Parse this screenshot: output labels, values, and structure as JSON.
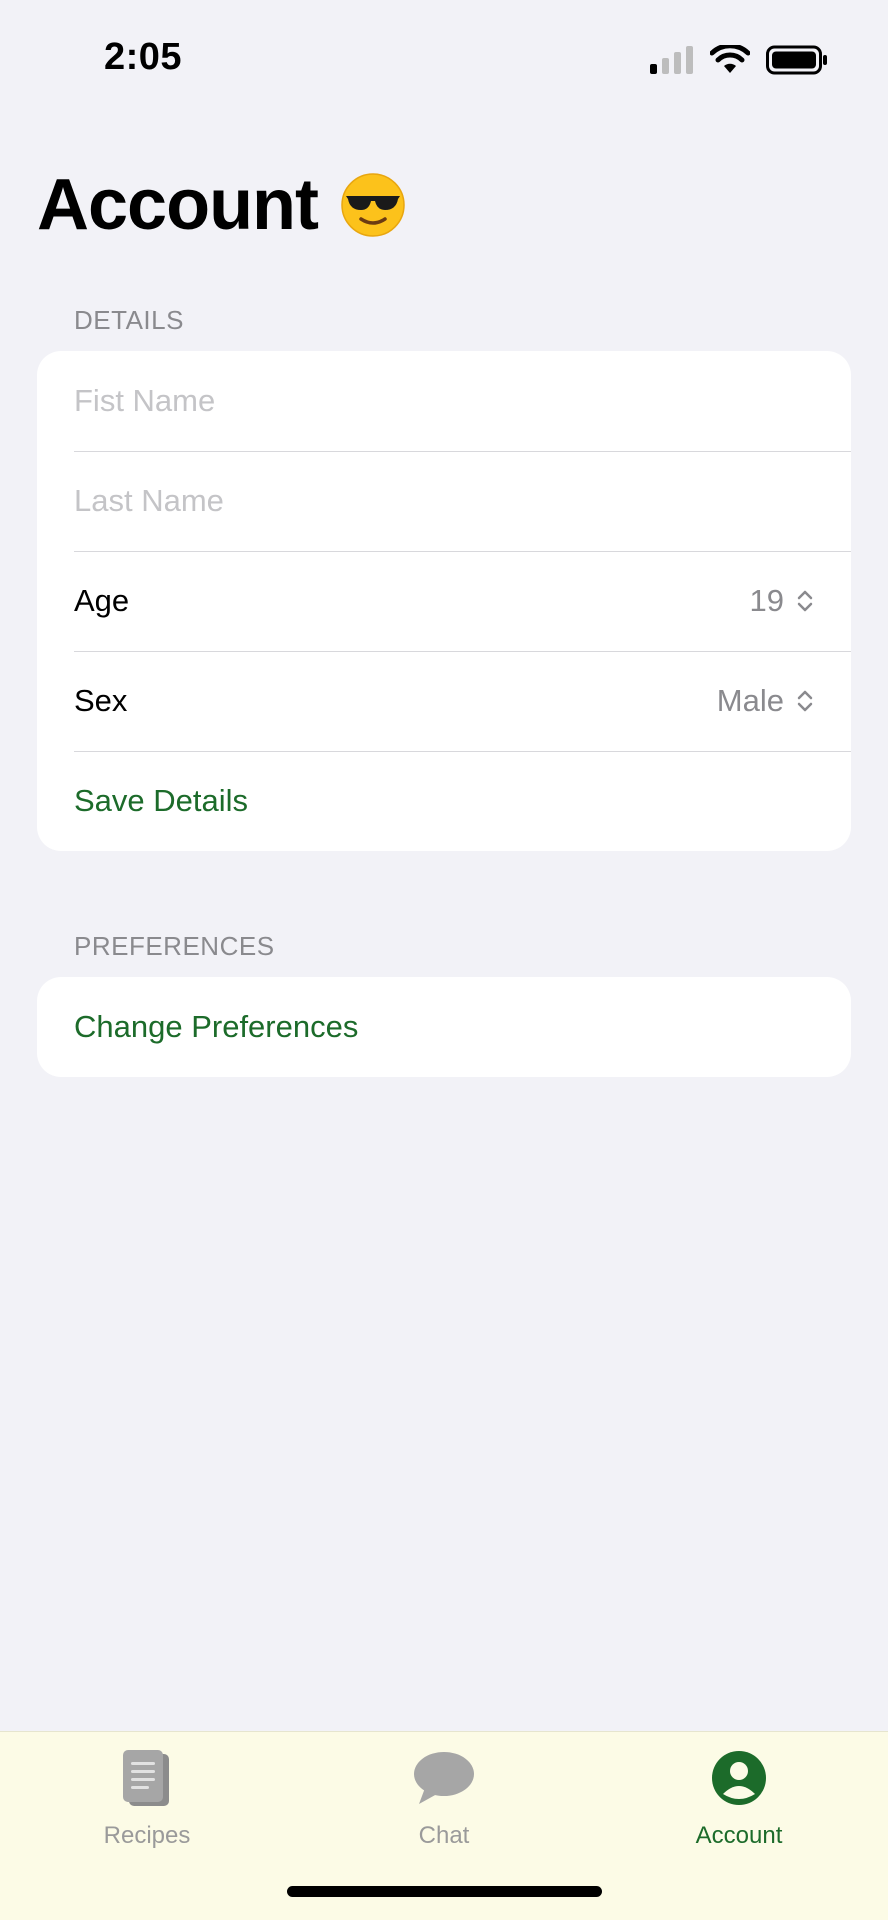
{
  "status_bar": {
    "time": "2:05"
  },
  "page": {
    "title": "Account",
    "title_icon": "smiling-face-with-sunglasses-icon"
  },
  "details": {
    "header": "DETAILS",
    "first_name_placeholder": "Fist Name",
    "last_name_placeholder": "Last Name",
    "age_label": "Age",
    "age_value": "19",
    "sex_label": "Sex",
    "sex_value": "Male",
    "save_label": "Save Details"
  },
  "preferences": {
    "header": "PREFERENCES",
    "change_label": "Change Preferences"
  },
  "tab_bar": {
    "tabs": [
      {
        "label": "Recipes",
        "icon": "recipe-book-icon",
        "active": false
      },
      {
        "label": "Chat",
        "icon": "chat-bubble-icon",
        "active": false
      },
      {
        "label": "Account",
        "icon": "person-circle-icon",
        "active": true
      }
    ]
  },
  "colors": {
    "accent": "#1c6b2a",
    "background": "#f2f2f7",
    "tab_bar_background": "#fcfbe6",
    "secondary_text": "#8a8a8e"
  }
}
